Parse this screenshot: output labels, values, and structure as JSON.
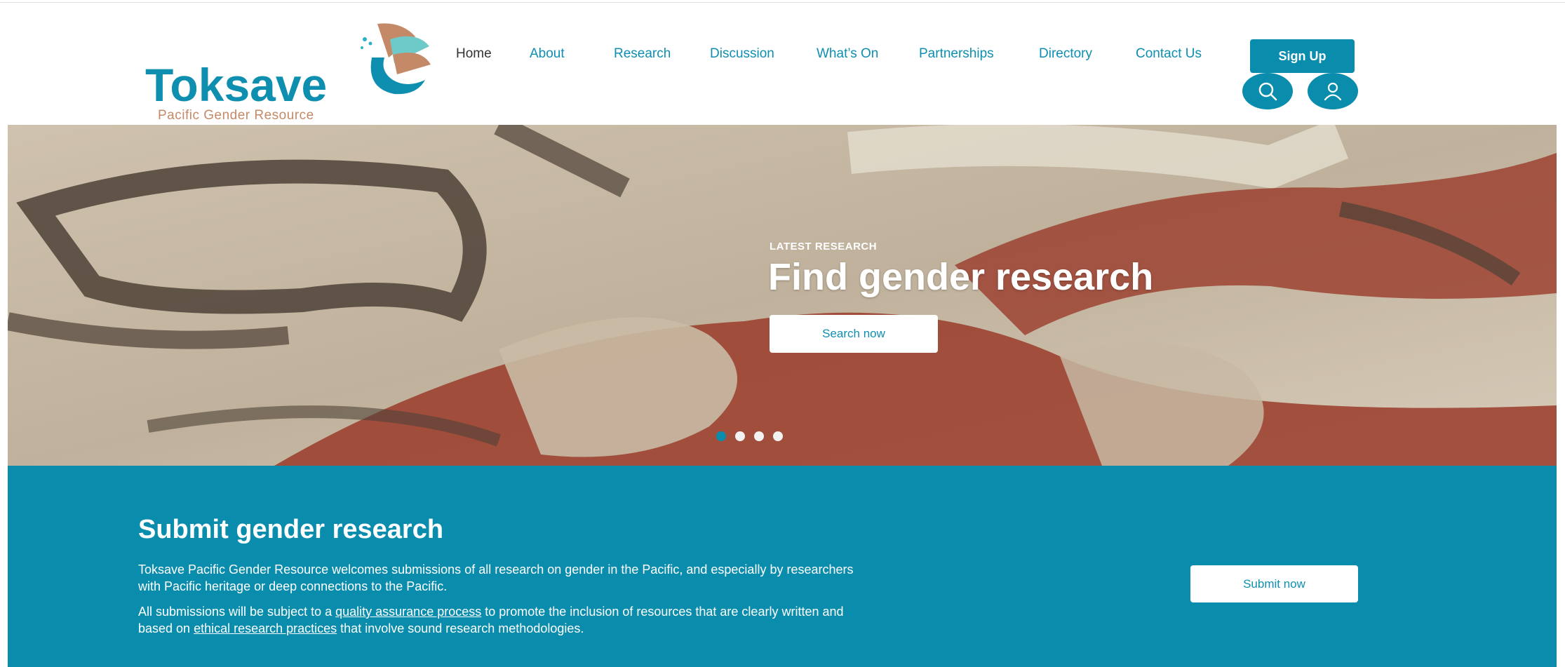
{
  "brand": {
    "name": "Toksave",
    "tagline": "Pacific Gender Resource",
    "colors": {
      "teal": "#0a8cad",
      "logo_teal": "#0f8fb0",
      "logo_rust": "#c48a68",
      "hero_red": "#9a3b2a"
    }
  },
  "nav": {
    "items": [
      {
        "label": "Home"
      },
      {
        "label": "About"
      },
      {
        "label": "Research"
      },
      {
        "label": "Discussion"
      },
      {
        "label": "What’s On"
      },
      {
        "label": "Partnerships"
      },
      {
        "label": "Directory"
      },
      {
        "label": "Contact Us"
      }
    ],
    "signup_label": "Sign Up",
    "search_icon": "search-icon",
    "user_icon": "user-icon"
  },
  "hero": {
    "eyebrow": "LATEST RESEARCH",
    "title": "Find gender research",
    "button_label": "Search now",
    "slides": {
      "count": 4,
      "active": 1
    }
  },
  "submit": {
    "title": "Submit gender research",
    "para1": "Toksave Pacific Gender Resource welcomes submissions of all research on gender in the Pacific, and especially by researchers with Pacific heritage or deep connections to the Pacific.",
    "para2_before": "All submissions will be subject to a ",
    "para2_link1": "quality assurance process",
    "para2_middle": " to promote the inclusion of resources that are clearly written and based on ",
    "para2_link2": "ethical research practices",
    "para2_after": " that involve sound research methodologies.",
    "button_label": "Submit now"
  }
}
